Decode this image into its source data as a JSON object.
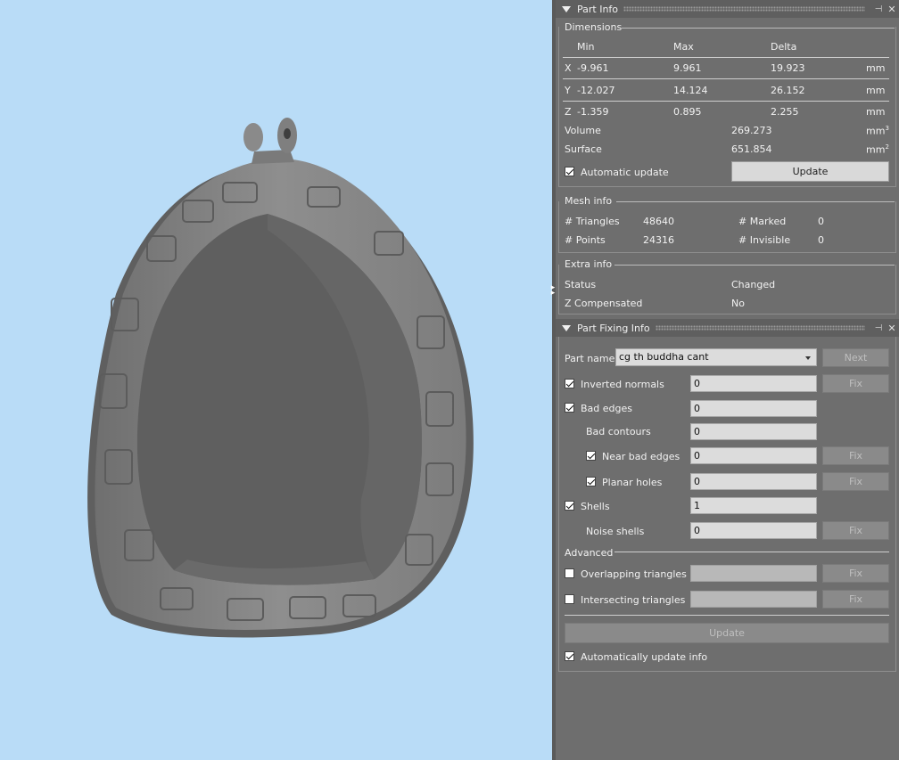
{
  "part_info": {
    "title": "Part Info",
    "dimensions": {
      "legend": "Dimensions",
      "headers": {
        "min": "Min",
        "max": "Max",
        "delta": "Delta"
      },
      "rows": [
        {
          "axis": "X",
          "min": "-9.961",
          "max": "9.961",
          "delta": "19.923",
          "unit": "mm"
        },
        {
          "axis": "Y",
          "min": "-12.027",
          "max": "14.124",
          "delta": "26.152",
          "unit": "mm"
        },
        {
          "axis": "Z",
          "min": "-1.359",
          "max": "0.895",
          "delta": "2.255",
          "unit": "mm"
        }
      ],
      "volume_label": "Volume",
      "volume_value": "269.273",
      "volume_unit": "mm",
      "volume_unit_sup": "3",
      "surface_label": "Surface",
      "surface_value": "651.854",
      "surface_unit": "mm",
      "surface_unit_sup": "2",
      "auto_update_label": "Automatic update",
      "auto_update_checked": true,
      "update_button": "Update"
    },
    "mesh_info": {
      "legend": "Mesh info",
      "triangles_label": "# Triangles",
      "triangles_value": "48640",
      "points_label": "# Points",
      "points_value": "24316",
      "marked_label": "# Marked",
      "marked_value": "0",
      "invisible_label": "# Invisible",
      "invisible_value": "0"
    },
    "extra_info": {
      "legend": "Extra info",
      "status_label": "Status",
      "status_value": "Changed",
      "zcomp_label": "Z Compensated",
      "zcomp_value": "No"
    }
  },
  "part_fixing": {
    "title": "Part Fixing Info",
    "part_name_label": "Part name",
    "part_name_value": "cg th buddha cant",
    "next_button": "Next",
    "fix_label": "Fix",
    "rows": {
      "inverted_normals": {
        "label": "Inverted normals",
        "value": "0"
      },
      "bad_edges": {
        "label": "Bad edges",
        "value": "0"
      },
      "bad_contours": {
        "label": "Bad contours",
        "value": "0"
      },
      "near_bad_edges": {
        "label": "Near bad edges",
        "value": "0"
      },
      "planar_holes": {
        "label": "Planar holes",
        "value": "0"
      },
      "shells": {
        "label": "Shells",
        "value": "1"
      },
      "noise_shells": {
        "label": "Noise shells",
        "value": "0"
      },
      "overlapping_triangles": {
        "label": "Overlapping triangles",
        "value": ""
      },
      "intersecting_triangles": {
        "label": "Intersecting triangles",
        "value": ""
      }
    },
    "advanced_legend": "Advanced",
    "update_button": "Update",
    "auto_update_label": "Automatically update info"
  },
  "colors": {
    "viewport_bg": "#b9dcf7",
    "panel_bg": "#6e6e6e",
    "model": "#8a8a8a"
  }
}
